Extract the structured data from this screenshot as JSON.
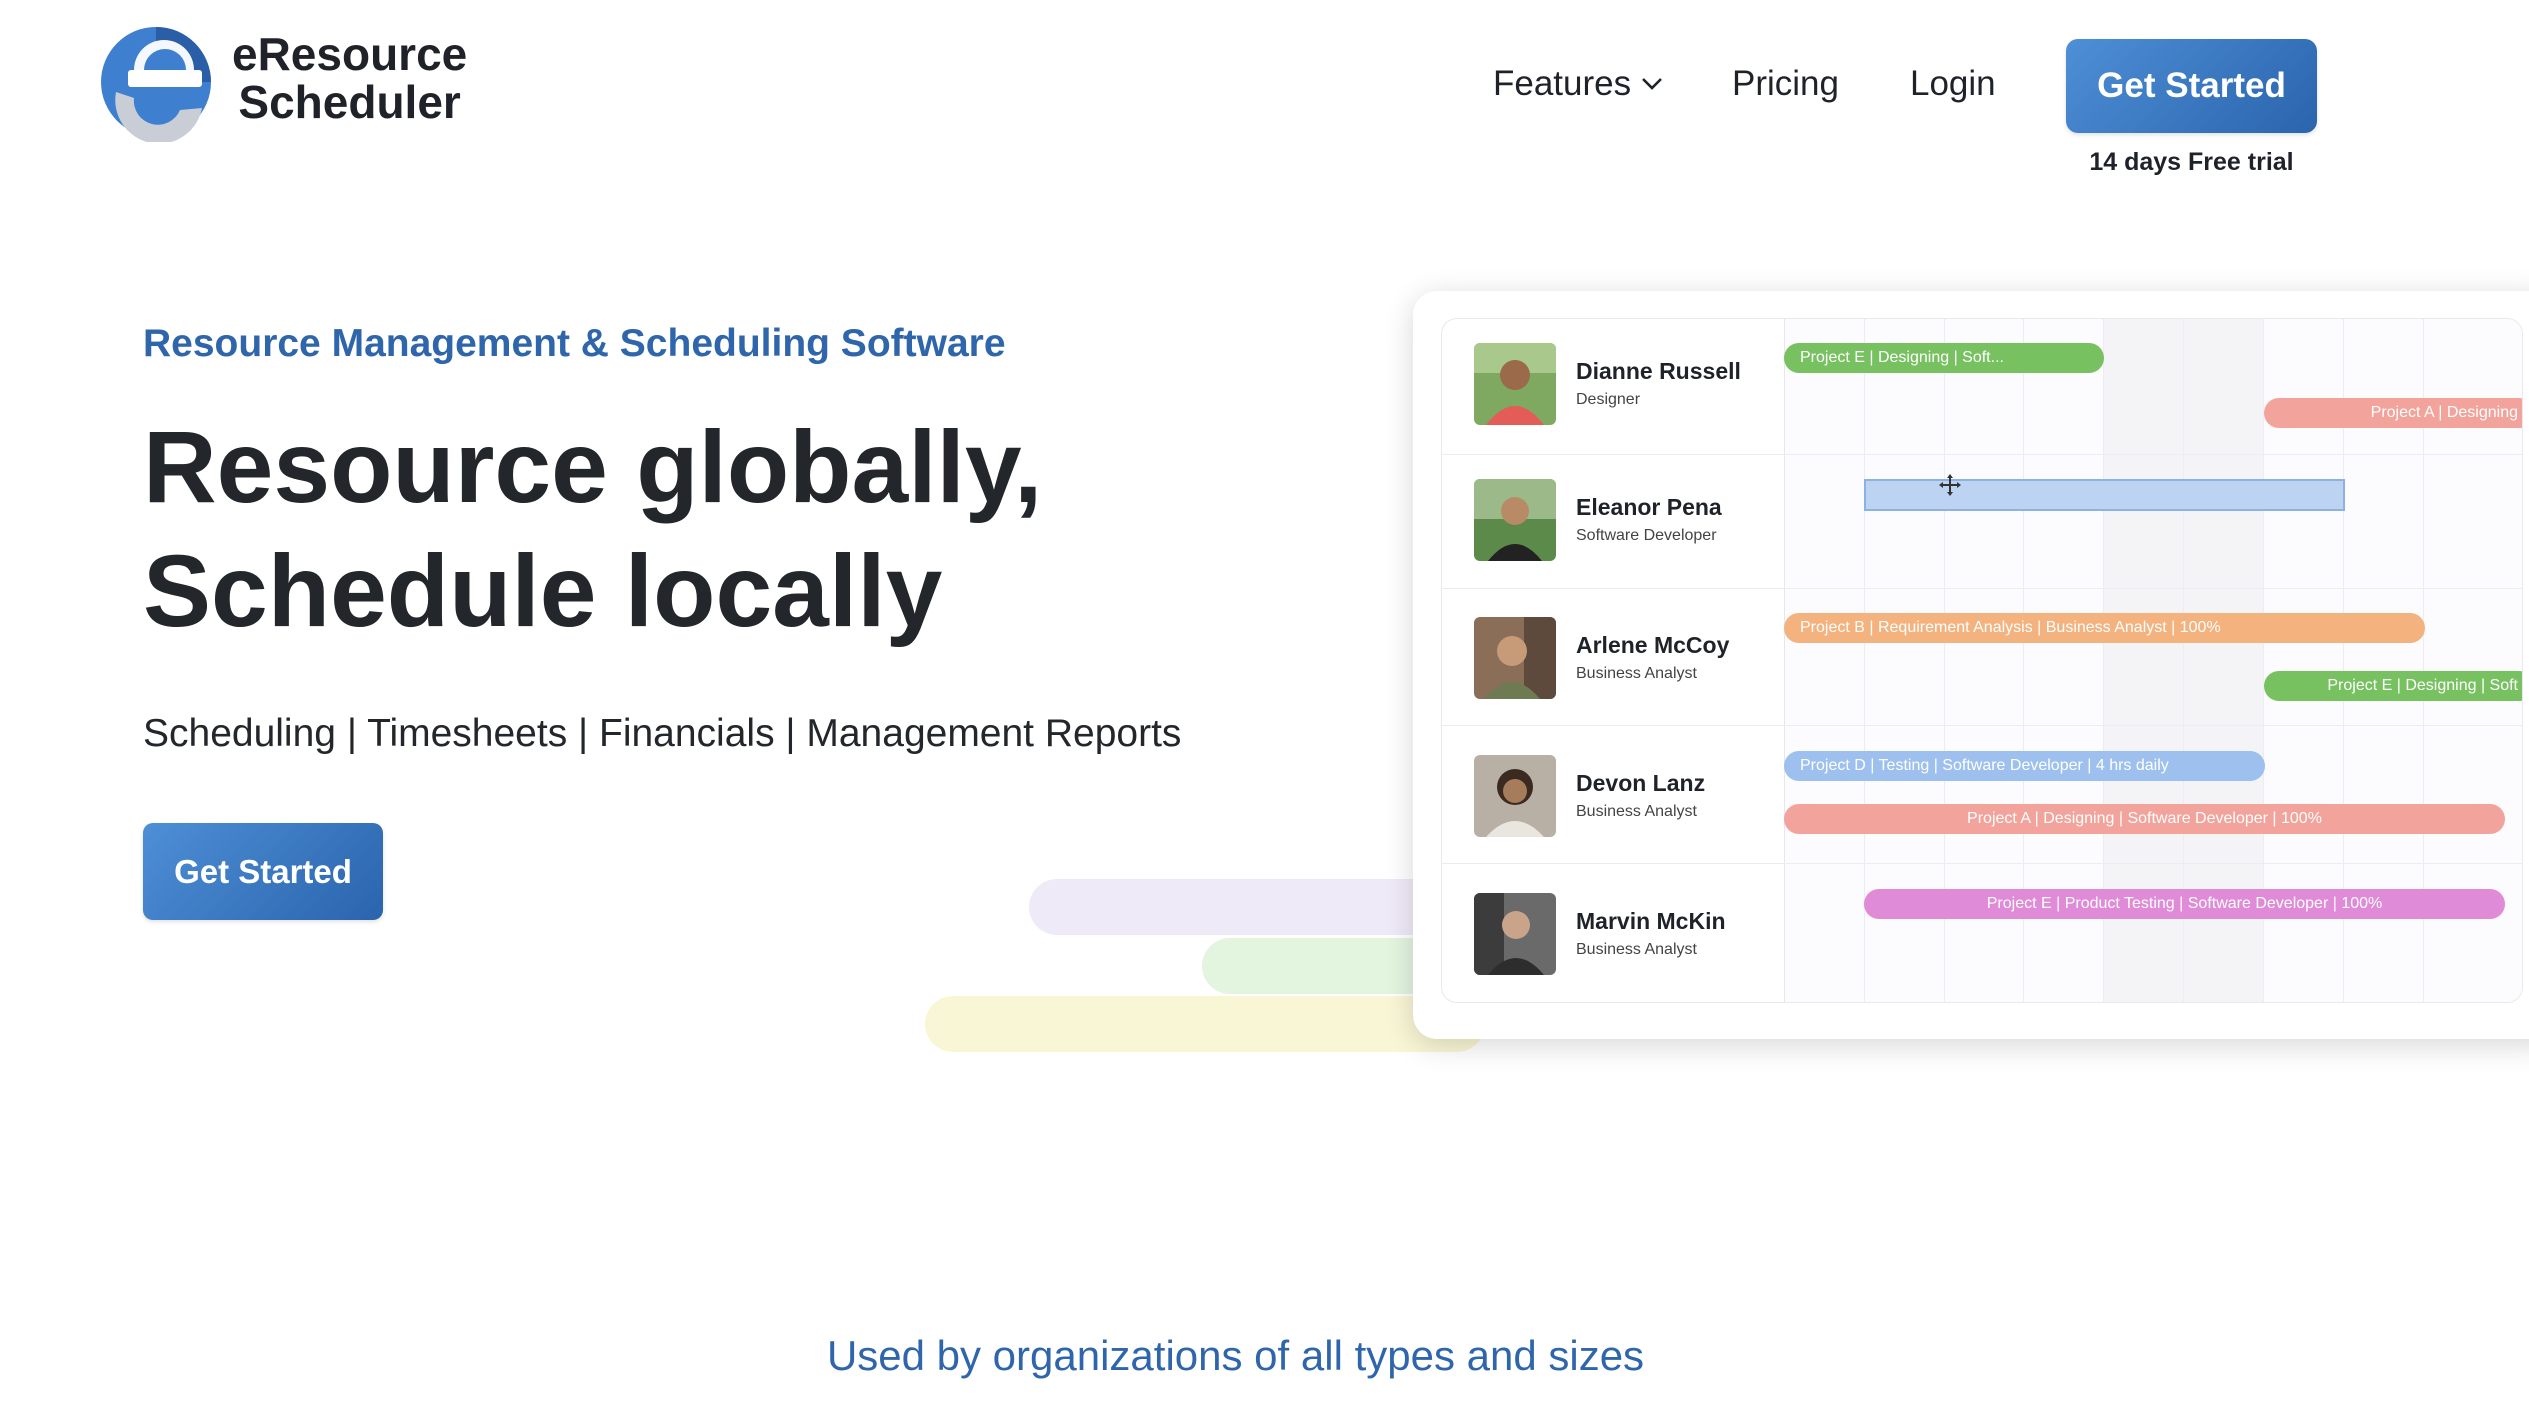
{
  "brand": {
    "line1": "eResource",
    "line2": "Scheduler"
  },
  "nav": {
    "features": "Features",
    "pricing": "Pricing",
    "login": "Login",
    "cta": "Get Started",
    "trial_note": "14 days Free trial"
  },
  "hero": {
    "eyebrow": "Resource Management & Scheduling Software",
    "headline_line1": "Resource globally,",
    "headline_line2": "Schedule locally",
    "features_line": "Scheduling | Timesheets | Financials | Management Reports",
    "cta": "Get Started"
  },
  "scheduler": {
    "people": [
      {
        "name": "Dianne Russell",
        "role": "Designer"
      },
      {
        "name": "Eleanor Pena",
        "role": "Software Developer"
      },
      {
        "name": "Arlene McCoy",
        "role": "Business Analyst"
      },
      {
        "name": "Devon Lanz",
        "role": "Business Analyst"
      },
      {
        "name": "Marvin McKin",
        "role": "Business Analyst"
      }
    ],
    "bars": [
      {
        "label": "Project E | Designing | Soft...",
        "color": "#77c160"
      },
      {
        "label": "Project A | Designing",
        "color": "#f2a39b"
      },
      {
        "label": "Project B | Requirement Analysis | Business Analyst | 100%",
        "color": "#f4b27e"
      },
      {
        "label": "Project E | Designing | Soft",
        "color": "#77c160"
      },
      {
        "label": "Project D | Testing | Software Developer | 4 hrs daily",
        "color": "#9dc0ee"
      },
      {
        "label": "Project A | Designing | Software Developer | 100%",
        "color": "#f2a39b"
      },
      {
        "label": "Project E | Product Testing | Software Developer | 100%",
        "color": "#df8bd8"
      }
    ]
  },
  "footer": {
    "used_by": "Used by organizations of all types and sizes"
  },
  "colors": {
    "brand_blue": "#2f66ab",
    "button_gradient_start": "#4e8fd6",
    "button_gradient_end": "#2a64ad"
  }
}
